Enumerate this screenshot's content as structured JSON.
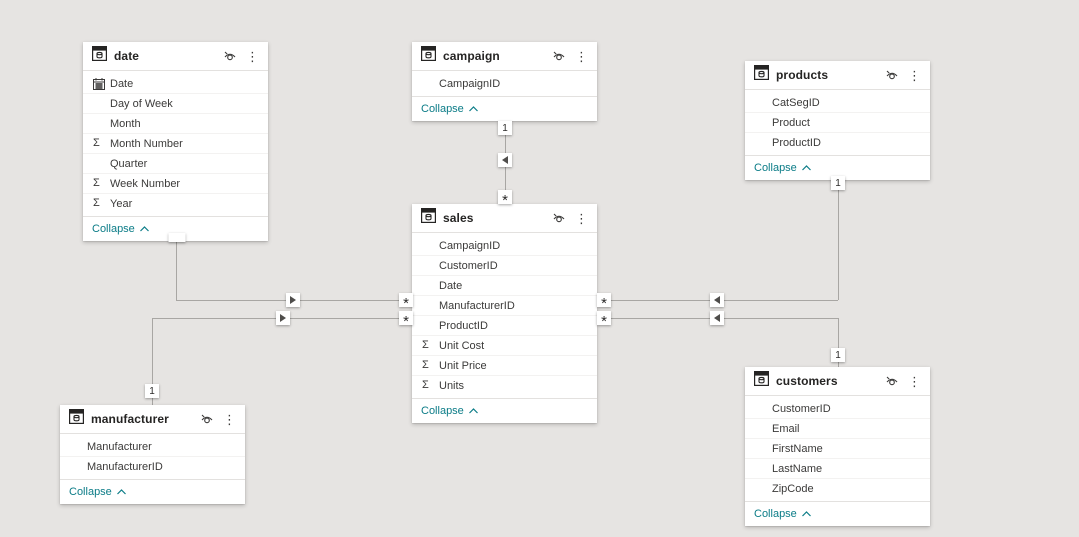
{
  "colors": {
    "canvas_bg": "#e6e4e2",
    "card_bg": "#ffffff",
    "accent_teal": "#0b7c87",
    "relationship_line": "#a8a6a3",
    "field_text": "#3b3a39",
    "title_text": "#252423"
  },
  "glyphs": {
    "sigma": "Σ",
    "more": "⋮"
  },
  "tables": {
    "date": {
      "title": "date",
      "collapse": "Collapse",
      "fields": [
        {
          "name": "Date",
          "icon": "calendar-icon"
        },
        {
          "name": "Day of Week",
          "icon": "none"
        },
        {
          "name": "Month",
          "icon": "none"
        },
        {
          "name": "Month Number",
          "icon": "sigma-icon"
        },
        {
          "name": "Quarter",
          "icon": "none"
        },
        {
          "name": "Week Number",
          "icon": "sigma-icon"
        },
        {
          "name": "Year",
          "icon": "sigma-icon"
        }
      ]
    },
    "campaign": {
      "title": "campaign",
      "collapse": "Collapse",
      "fields": [
        {
          "name": "CampaignID",
          "icon": "none"
        }
      ]
    },
    "products": {
      "title": "products",
      "collapse": "Collapse",
      "fields": [
        {
          "name": "CatSegID",
          "icon": "none"
        },
        {
          "name": "Product",
          "icon": "none"
        },
        {
          "name": "ProductID",
          "icon": "none"
        }
      ]
    },
    "sales": {
      "title": "sales",
      "collapse": "Collapse",
      "fields": [
        {
          "name": "CampaignID",
          "icon": "none"
        },
        {
          "name": "CustomerID",
          "icon": "none"
        },
        {
          "name": "Date",
          "icon": "none"
        },
        {
          "name": "ManufacturerID",
          "icon": "none"
        },
        {
          "name": "ProductID",
          "icon": "none"
        },
        {
          "name": "Unit Cost",
          "icon": "sigma-icon"
        },
        {
          "name": "Unit Price",
          "icon": "sigma-icon"
        },
        {
          "name": "Units",
          "icon": "sigma-icon"
        }
      ]
    },
    "manufacturer": {
      "title": "manufacturer",
      "collapse": "Collapse",
      "fields": [
        {
          "name": "Manufacturer",
          "icon": "none"
        },
        {
          "name": "ManufacturerID",
          "icon": "none"
        }
      ]
    },
    "customers": {
      "title": "customers",
      "collapse": "Collapse",
      "fields": [
        {
          "name": "CustomerID",
          "icon": "none"
        },
        {
          "name": "Email",
          "icon": "none"
        },
        {
          "name": "FirstName",
          "icon": "none"
        },
        {
          "name": "LastName",
          "icon": "none"
        },
        {
          "name": "ZipCode",
          "icon": "none"
        }
      ]
    }
  },
  "relationships": [
    {
      "from": "campaign",
      "to": "sales",
      "from_cardinality": "1",
      "to_cardinality": "*"
    },
    {
      "from": "date",
      "to": "sales",
      "from_cardinality": "",
      "to_cardinality": "*"
    },
    {
      "from": "manufacturer",
      "to": "sales",
      "from_cardinality": "1",
      "to_cardinality": "*"
    },
    {
      "from": "products",
      "to": "sales",
      "from_cardinality": "1",
      "to_cardinality": "*"
    },
    {
      "from": "customers",
      "to": "sales",
      "from_cardinality": "1",
      "to_cardinality": "*"
    }
  ]
}
